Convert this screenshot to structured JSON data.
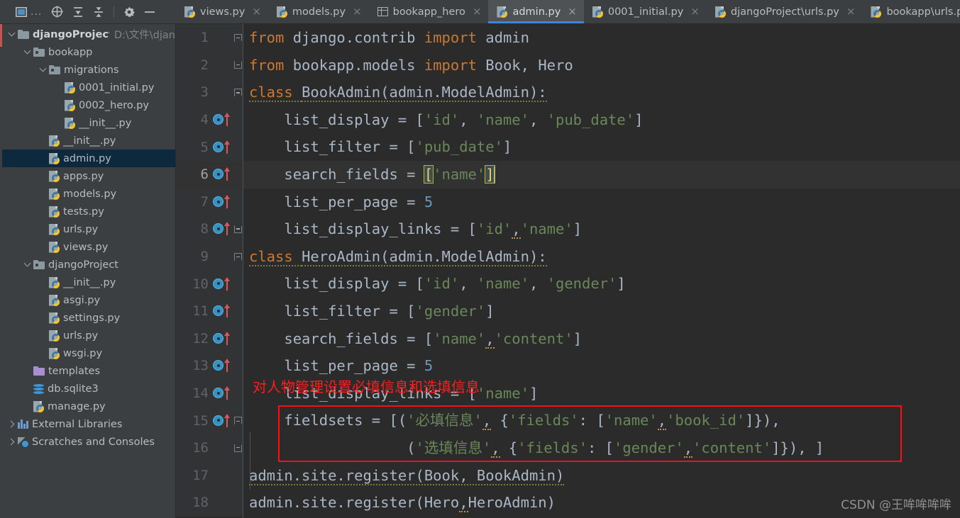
{
  "toolbar": {
    "icons": [
      {
        "name": "project-view-icon",
        "label": "project-view"
      },
      {
        "name": "ellipsis-icon",
        "label": "..."
      },
      {
        "name": "locate-target-icon",
        "label": "select-opened-file"
      },
      {
        "name": "expand-all-icon",
        "label": "expand-all"
      },
      {
        "name": "collapse-all-icon",
        "label": "collapse-all"
      },
      {
        "name": "gear-icon",
        "label": "settings"
      },
      {
        "name": "minimize-icon",
        "label": "hide"
      }
    ]
  },
  "tabs": [
    {
      "label": "views.py",
      "icon": "python-file-icon",
      "active": false,
      "close": "×"
    },
    {
      "label": "models.py",
      "icon": "python-file-icon",
      "active": false,
      "close": "×"
    },
    {
      "label": "bookapp_hero",
      "icon": "table-icon",
      "active": false,
      "close": "×"
    },
    {
      "label": "admin.py",
      "icon": "python-file-icon",
      "active": true,
      "close": "×"
    },
    {
      "label": "0001_initial.py",
      "icon": "python-file-icon",
      "active": false,
      "close": "×"
    },
    {
      "label": "djangoProject\\urls.py",
      "icon": "python-file-icon",
      "active": false,
      "close": "×"
    },
    {
      "label": "bookapp\\urls.py",
      "icon": "python-file-icon",
      "active": false,
      "close": ""
    }
  ],
  "tree": [
    {
      "label": "djangoProject",
      "path": "D:\\文件\\djan",
      "type": "folder-root",
      "indent": 0,
      "arrow": "open",
      "bold": true,
      "selected": false
    },
    {
      "label": "bookapp",
      "path": "",
      "type": "folder-module",
      "indent": 1,
      "arrow": "open",
      "bold": false,
      "selected": false
    },
    {
      "label": "migrations",
      "path": "",
      "type": "folder-module",
      "indent": 2,
      "arrow": "open",
      "bold": false,
      "selected": false
    },
    {
      "label": "0001_initial.py",
      "path": "",
      "type": "python",
      "indent": 3,
      "arrow": "",
      "bold": false,
      "selected": false
    },
    {
      "label": "0002_hero.py",
      "path": "",
      "type": "python",
      "indent": 3,
      "arrow": "",
      "bold": false,
      "selected": false
    },
    {
      "label": "__init__.py",
      "path": "",
      "type": "python",
      "indent": 3,
      "arrow": "",
      "bold": false,
      "selected": false
    },
    {
      "label": "__init__.py",
      "path": "",
      "type": "python",
      "indent": 2,
      "arrow": "",
      "bold": false,
      "selected": false
    },
    {
      "label": "admin.py",
      "path": "",
      "type": "python",
      "indent": 2,
      "arrow": "",
      "bold": false,
      "selected": true
    },
    {
      "label": "apps.py",
      "path": "",
      "type": "python",
      "indent": 2,
      "arrow": "",
      "bold": false,
      "selected": false
    },
    {
      "label": "models.py",
      "path": "",
      "type": "python",
      "indent": 2,
      "arrow": "",
      "bold": false,
      "selected": false
    },
    {
      "label": "tests.py",
      "path": "",
      "type": "python",
      "indent": 2,
      "arrow": "",
      "bold": false,
      "selected": false
    },
    {
      "label": "urls.py",
      "path": "",
      "type": "python",
      "indent": 2,
      "arrow": "",
      "bold": false,
      "selected": false
    },
    {
      "label": "views.py",
      "path": "",
      "type": "python",
      "indent": 2,
      "arrow": "",
      "bold": false,
      "selected": false
    },
    {
      "label": "djangoProject",
      "path": "",
      "type": "folder-module",
      "indent": 1,
      "arrow": "open",
      "bold": false,
      "selected": false
    },
    {
      "label": "__init__.py",
      "path": "",
      "type": "python",
      "indent": 2,
      "arrow": "",
      "bold": false,
      "selected": false
    },
    {
      "label": "asgi.py",
      "path": "",
      "type": "python",
      "indent": 2,
      "arrow": "",
      "bold": false,
      "selected": false
    },
    {
      "label": "settings.py",
      "path": "",
      "type": "python",
      "indent": 2,
      "arrow": "",
      "bold": false,
      "selected": false
    },
    {
      "label": "urls.py",
      "path": "",
      "type": "python",
      "indent": 2,
      "arrow": "",
      "bold": false,
      "selected": false
    },
    {
      "label": "wsgi.py",
      "path": "",
      "type": "python",
      "indent": 2,
      "arrow": "",
      "bold": false,
      "selected": false
    },
    {
      "label": "templates",
      "path": "",
      "type": "folder-templates",
      "indent": 1,
      "arrow": "",
      "bold": false,
      "selected": false
    },
    {
      "label": "db.sqlite3",
      "path": "",
      "type": "database",
      "indent": 1,
      "arrow": "",
      "bold": false,
      "selected": false
    },
    {
      "label": "manage.py",
      "path": "",
      "type": "python",
      "indent": 1,
      "arrow": "",
      "bold": false,
      "selected": false
    },
    {
      "label": "External Libraries",
      "path": "",
      "type": "libraries",
      "indent": 0,
      "arrow": "closed",
      "bold": false,
      "selected": false
    },
    {
      "label": "Scratches and Consoles",
      "path": "",
      "type": "scratches",
      "indent": 0,
      "arrow": "closed",
      "bold": false,
      "selected": false
    }
  ],
  "editor": {
    "file": "admin.py",
    "current_line": 6,
    "lines": [
      {
        "num": "1",
        "marker": false,
        "fold": "down",
        "current": false,
        "tokens": [
          {
            "t": "from ",
            "c": "kw"
          },
          {
            "t": "django.contrib ",
            "c": "def"
          },
          {
            "t": "import ",
            "c": "kw"
          },
          {
            "t": "admin",
            "c": "def"
          }
        ]
      },
      {
        "num": "2",
        "marker": false,
        "fold": "up",
        "current": false,
        "tokens": [
          {
            "t": "from ",
            "c": "kw"
          },
          {
            "t": "bookapp.models ",
            "c": "def"
          },
          {
            "t": "import ",
            "c": "kw"
          },
          {
            "t": "Book, Hero",
            "c": "def"
          }
        ]
      },
      {
        "num": "3",
        "marker": false,
        "fold": "down",
        "current": false,
        "tokens": [
          {
            "t": "class ",
            "c": "kw squig"
          },
          {
            "t": "BookAdmin(admin.ModelAdmin):",
            "c": "def squig"
          }
        ]
      },
      {
        "num": "4",
        "marker": true,
        "fold": "",
        "current": false,
        "tokens": [
          {
            "t": "    list_display = [",
            "c": "def"
          },
          {
            "t": "'id'",
            "c": "str"
          },
          {
            "t": ", ",
            "c": "def"
          },
          {
            "t": "'name'",
            "c": "str"
          },
          {
            "t": ", ",
            "c": "def"
          },
          {
            "t": "'pub_date'",
            "c": "str"
          },
          {
            "t": "]",
            "c": "def"
          }
        ]
      },
      {
        "num": "5",
        "marker": true,
        "fold": "",
        "current": false,
        "tokens": [
          {
            "t": "    list_filter = [",
            "c": "def"
          },
          {
            "t": "'pub_date'",
            "c": "str"
          },
          {
            "t": "]",
            "c": "def"
          }
        ]
      },
      {
        "num": "6",
        "marker": true,
        "fold": "",
        "current": true,
        "tokens": [
          {
            "t": "    search_fields = ",
            "c": "def"
          },
          {
            "t": "[",
            "c": "hlbrk"
          },
          {
            "t": "'name'",
            "c": "str"
          },
          {
            "t": "]",
            "c": "hlbrk"
          },
          {
            "t": "",
            "c": "caret"
          }
        ]
      },
      {
        "num": "7",
        "marker": true,
        "fold": "",
        "current": false,
        "tokens": [
          {
            "t": "    list_per_page = ",
            "c": "def"
          },
          {
            "t": "5",
            "c": "num"
          }
        ]
      },
      {
        "num": "8",
        "marker": true,
        "fold": "up",
        "current": false,
        "tokens": [
          {
            "t": "    list_display_links = [",
            "c": "def"
          },
          {
            "t": "'id'",
            "c": "str"
          },
          {
            "t": ",",
            "c": "comma-warn"
          },
          {
            "t": "'name'",
            "c": "str"
          },
          {
            "t": "]",
            "c": "def"
          }
        ]
      },
      {
        "num": "9",
        "marker": false,
        "fold": "down",
        "current": false,
        "tokens": [
          {
            "t": "class ",
            "c": "kw squig"
          },
          {
            "t": "HeroAdmin(admin.ModelAdmin):",
            "c": "def squig"
          }
        ]
      },
      {
        "num": "10",
        "marker": true,
        "fold": "",
        "current": false,
        "tokens": [
          {
            "t": "    list_display = [",
            "c": "def"
          },
          {
            "t": "'id'",
            "c": "str"
          },
          {
            "t": ", ",
            "c": "def"
          },
          {
            "t": "'name'",
            "c": "str"
          },
          {
            "t": ", ",
            "c": "def"
          },
          {
            "t": "'gender'",
            "c": "str"
          },
          {
            "t": "]",
            "c": "def"
          }
        ]
      },
      {
        "num": "11",
        "marker": true,
        "fold": "",
        "current": false,
        "tokens": [
          {
            "t": "    list_filter = [",
            "c": "def"
          },
          {
            "t": "'gender'",
            "c": "str"
          },
          {
            "t": "]",
            "c": "def"
          }
        ]
      },
      {
        "num": "12",
        "marker": true,
        "fold": "",
        "current": false,
        "tokens": [
          {
            "t": "    search_fields = [",
            "c": "def"
          },
          {
            "t": "'name'",
            "c": "str"
          },
          {
            "t": ",",
            "c": "comma-warn"
          },
          {
            "t": "'content'",
            "c": "str"
          },
          {
            "t": "]",
            "c": "def"
          }
        ]
      },
      {
        "num": "13",
        "marker": true,
        "fold": "",
        "current": false,
        "tokens": [
          {
            "t": "    list_per_page = ",
            "c": "def"
          },
          {
            "t": "5",
            "c": "num"
          }
        ]
      },
      {
        "num": "14",
        "marker": true,
        "fold": "",
        "current": false,
        "tokens": [
          {
            "t": "    list_display_links = [",
            "c": "def"
          },
          {
            "t": "'name'",
            "c": "str"
          },
          {
            "t": "]",
            "c": "def"
          }
        ]
      },
      {
        "num": "15",
        "marker": true,
        "fold": "down",
        "current": false,
        "tokens": [
          {
            "t": "    fieldsets = [(",
            "c": "def"
          },
          {
            "t": "'必填信息'",
            "c": "str"
          },
          {
            "t": ",",
            "c": "comma-warn"
          },
          {
            "t": " {",
            "c": "def"
          },
          {
            "t": "'fields'",
            "c": "str"
          },
          {
            "t": ": [",
            "c": "def"
          },
          {
            "t": "'name'",
            "c": "str"
          },
          {
            "t": ",",
            "c": "comma-warn"
          },
          {
            "t": "'book_id'",
            "c": "str"
          },
          {
            "t": "]}),",
            "c": "def"
          }
        ]
      },
      {
        "num": "16",
        "marker": false,
        "fold": "up",
        "current": false,
        "tokens": [
          {
            "t": "                  (",
            "c": "def"
          },
          {
            "t": "'选填信息'",
            "c": "str"
          },
          {
            "t": ",",
            "c": "comma-warn"
          },
          {
            "t": " {",
            "c": "def"
          },
          {
            "t": "'fields'",
            "c": "str"
          },
          {
            "t": ": [",
            "c": "def"
          },
          {
            "t": "'gender'",
            "c": "str"
          },
          {
            "t": ",",
            "c": "comma-warn"
          },
          {
            "t": "'content'",
            "c": "str"
          },
          {
            "t": "]}), ]",
            "c": "def"
          }
        ]
      },
      {
        "num": "17",
        "marker": false,
        "fold": "",
        "current": false,
        "tokens": [
          {
            "t": "admin.site.register(Book, BookAdmin)",
            "c": "def squig"
          }
        ]
      },
      {
        "num": "18",
        "marker": false,
        "fold": "",
        "current": false,
        "tokens": [
          {
            "t": "admin.site.register(Hero",
            "c": "def"
          },
          {
            "t": ",",
            "c": "comma-warn"
          },
          {
            "t": "HeroAdmin)",
            "c": "def"
          }
        ]
      }
    ],
    "annotation": "对人物管理设置必填信息和选填信息"
  },
  "watermark": "CSDN @王哞哞哞哞",
  "colors": {
    "editor_bg": "#2b2b2b",
    "gutter_bg": "#313335",
    "panel_bg": "#3c3f41",
    "selection_bg": "#0d293e",
    "tab_active_bg": "#4e5254",
    "tab_underline": "#3c85d8",
    "annotation_red": "#ff1c1c",
    "keyword": "#cc7832",
    "string": "#6a8759",
    "number": "#6897bb",
    "default_text": "#a9b7c6"
  }
}
